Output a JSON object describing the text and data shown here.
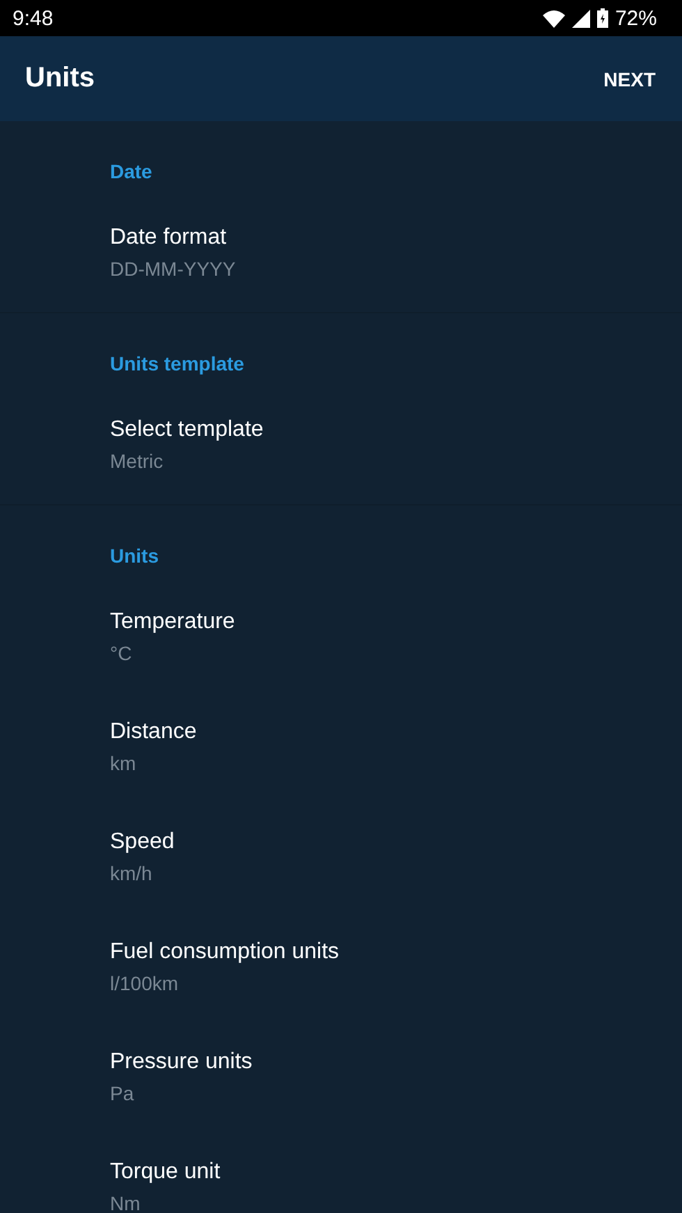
{
  "status_bar": {
    "time": "9:48",
    "battery": "72%"
  },
  "app_bar": {
    "title": "Units",
    "action": "NEXT"
  },
  "sections": [
    {
      "header": "Date",
      "items": [
        {
          "title": "Date format",
          "value": "DD-MM-YYYY"
        }
      ]
    },
    {
      "header": "Units template",
      "items": [
        {
          "title": "Select template",
          "value": "Metric"
        }
      ]
    },
    {
      "header": "Units",
      "items": [
        {
          "title": "Temperature",
          "value": "°C"
        },
        {
          "title": "Distance",
          "value": "km"
        },
        {
          "title": "Speed",
          "value": "km/h"
        },
        {
          "title": "Fuel consumption units",
          "value": "l/100km"
        },
        {
          "title": "Pressure units",
          "value": "Pa"
        },
        {
          "title": "Torque unit",
          "value": "Nm"
        }
      ]
    }
  ]
}
